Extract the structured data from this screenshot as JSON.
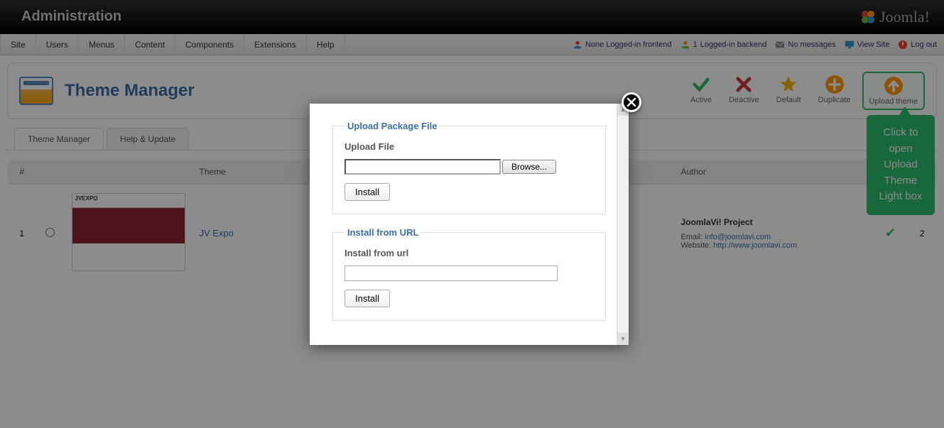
{
  "header": {
    "title": "Administration",
    "brand": "Joomla!"
  },
  "menu": {
    "items": [
      "Site",
      "Users",
      "Menus",
      "Content",
      "Components",
      "Extensions",
      "Help"
    ]
  },
  "status": {
    "frontend": "None Logged-in frontend",
    "backend_count": "1",
    "backend_label": "Logged-in backend",
    "no_messages": "No messages",
    "view_site": "View Site",
    "log_out": "Log out"
  },
  "page": {
    "title": "Theme Manager"
  },
  "toolbar": {
    "active": "Active",
    "deactive": "Deactive",
    "default": "Default",
    "duplicate": "Duplicate",
    "upload": "Upload theme"
  },
  "tabs": {
    "manager": "Theme Manager",
    "help": "Help & Update"
  },
  "table": {
    "headers": {
      "num": "#",
      "theme": "Theme",
      "author": "Author"
    },
    "row": {
      "num": "1",
      "theme_name": "JV Expo",
      "thumb_title": "JVEXPO",
      "author_title": "JoomlaVi! Project",
      "email_label": "Email:",
      "email": "info@joomlavi.com",
      "website_label": "Website:",
      "website": "http://www.joomlavi.com",
      "count": "2"
    }
  },
  "modal": {
    "upload_legend": "Upload Package File",
    "upload_label": "Upload File",
    "browse": "Browse...",
    "install": "Install",
    "url_legend": "Install from URL",
    "url_label": "Install from url"
  },
  "tooltip": {
    "text": "Click to open Upload Theme Light box"
  }
}
